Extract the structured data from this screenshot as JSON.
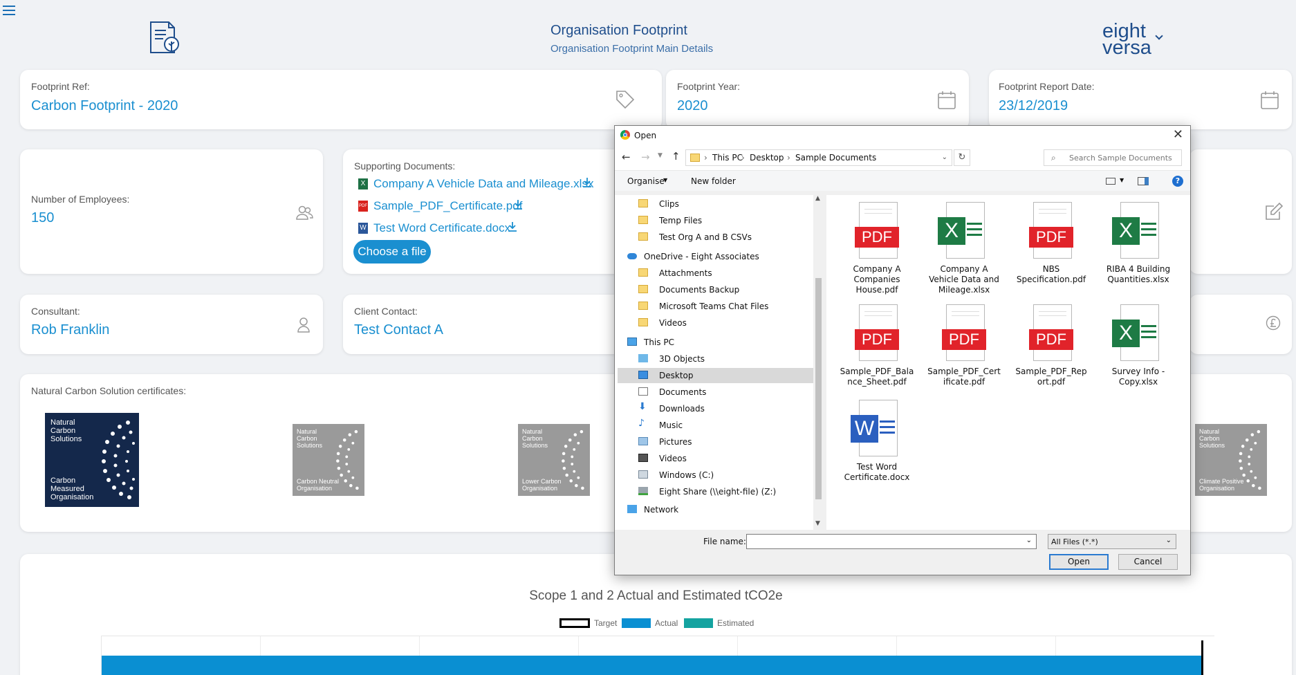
{
  "header": {
    "title": "Organisation Footprint",
    "subtitle": "Organisation Footprint Main Details",
    "brand_top": "eight",
    "brand_bottom": "versa"
  },
  "fields": {
    "ref_label": "Footprint Ref:",
    "ref_value": "Carbon Footprint - 2020",
    "year_label": "Footprint Year:",
    "year_value": "2020",
    "report_label": "Footprint Report Date:",
    "report_value": "23/12/2019",
    "employees_label": "Number of Employees:",
    "employees_value": "150",
    "consultant_label": "Consultant:",
    "consultant_value": "Rob Franklin",
    "client_label": "Client Contact:",
    "client_value": "Test Contact A"
  },
  "supporting": {
    "label": "Supporting Documents:",
    "files": [
      "Company A Vehicle Data and Mileage.xlsx",
      "Sample_PDF_Certificate.pdf",
      "Test Word Certificate.docx"
    ],
    "button": "Choose a file"
  },
  "certificates": {
    "label": "Natural Carbon Solution certificates:",
    "brand": "Natural Carbon Solutions",
    "items": [
      "Carbon Measured Organisation",
      "Carbon Neutral Organisation",
      "Lower Carbon Organisation",
      "Climate Positive Organisation"
    ]
  },
  "chart": {
    "title": "Scope 1 and 2 Actual and Estimated tCO2e",
    "legend": [
      "Target",
      "Actual",
      "Estimated"
    ],
    "colors": {
      "actual": "#0a8fd2",
      "estimated": "#14a3a0",
      "target": "#000000"
    }
  },
  "dialog": {
    "title": "Open",
    "breadcrumb": [
      "This PC",
      "Desktop",
      "Sample Documents"
    ],
    "search_placeholder": "Search Sample Documents",
    "organise": "Organise",
    "new_folder": "New folder",
    "nav": [
      "Clips",
      "Temp Files",
      "Test Org A and B CSVs",
      "OneDrive - Eight Associates",
      "Attachments",
      "Documents Backup",
      "Microsoft Teams Chat Files",
      "Videos",
      "This PC",
      "3D Objects",
      "Desktop",
      "Documents",
      "Downloads",
      "Music",
      "Pictures",
      "Videos",
      "Windows (C:)",
      "Eight Share (\\\\eight-file) (Z:)",
      "Network"
    ],
    "files": [
      {
        "line1": "Company A",
        "line2": "Companies",
        "line3": "House.pdf",
        "type": "pdf"
      },
      {
        "line1": "Company A",
        "line2": "Vehicle Data and",
        "line3": "Mileage.xlsx",
        "type": "xlsx"
      },
      {
        "line1": "NBS",
        "line2": "Specification.pdf",
        "line3": "",
        "type": "pdf"
      },
      {
        "line1": "RIBA 4 Building",
        "line2": "Quantities.xlsx",
        "line3": "",
        "type": "xlsx"
      },
      {
        "line1": "Sample_PDF_Bala",
        "line2": "nce_Sheet.pdf",
        "line3": "",
        "type": "pdf"
      },
      {
        "line1": "Sample_PDF_Cert",
        "line2": "ificate.pdf",
        "line3": "",
        "type": "pdf"
      },
      {
        "line1": "Sample_PDF_Rep",
        "line2": "ort.pdf",
        "line3": "",
        "type": "pdf"
      },
      {
        "line1": "Survey Info -",
        "line2": "Copy.xlsx",
        "line3": "",
        "type": "xlsx"
      },
      {
        "line1": "Test Word",
        "line2": "Certificate.docx",
        "line3": "",
        "type": "docx"
      }
    ],
    "pdf_badge": "PDF",
    "xlsx_badge": "X",
    "docx_badge": "W",
    "filename_label": "File name:",
    "filter": "All Files (*.*)",
    "open_btn": "Open",
    "cancel_btn": "Cancel"
  }
}
